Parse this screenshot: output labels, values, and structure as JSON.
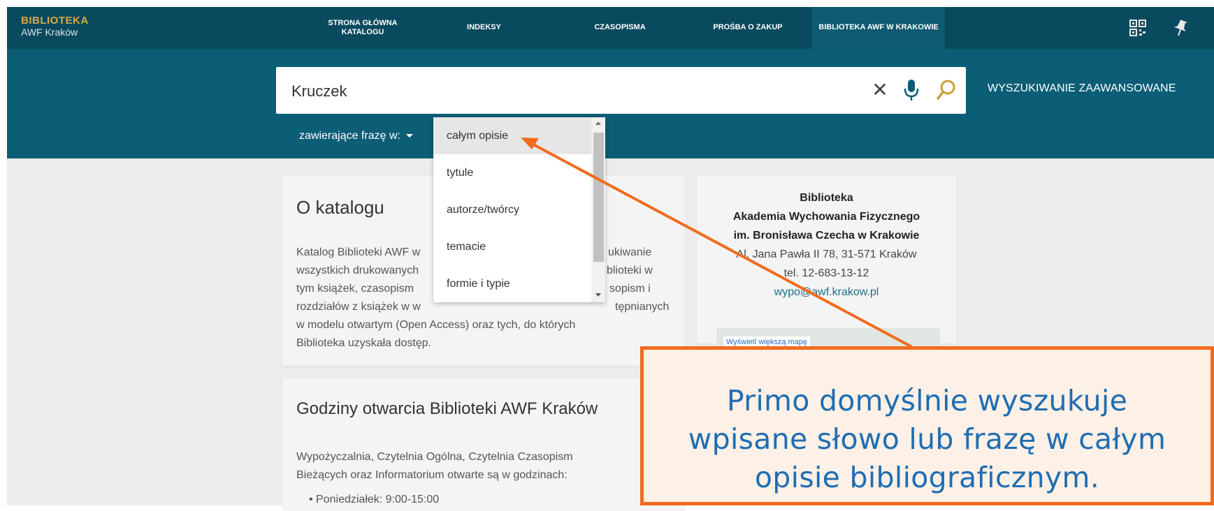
{
  "header": {
    "logo_line1": "BIBLIOTEKA",
    "logo_line2": "AWF Kraków",
    "nav": [
      {
        "label": "STRONA GŁÓWNA KATALOGU"
      },
      {
        "label": "INDEKSY"
      },
      {
        "label": "CZASOPISMA"
      },
      {
        "label": "PROŚBA O ZAKUP"
      },
      {
        "label": "BIBLIOTEKA AWF W KRAKOWIE"
      }
    ],
    "icons": [
      "qr-code-icon",
      "pin-icon"
    ]
  },
  "search": {
    "query": "Kruczek",
    "advanced_label": "WYSZUKIWANIE ZAAWANSOWANE",
    "scope_label": "zawierające frazę w:"
  },
  "scope_dropdown": {
    "options": [
      "całym opisie",
      "tytule",
      "autorze/twórcy",
      "temacie",
      "formie i typie"
    ],
    "selected": "całym opisie"
  },
  "about": {
    "title": "O katalogu",
    "lines": [
      "Katalog Biblioteki AWF w",
      "wszystkich drukowanych",
      "tym książek, czasopism",
      "rozdziałów z książek w w",
      "w modelu otwartym (Open Access) oraz tych, do których",
      "Biblioteka uzyskała dostęp."
    ],
    "right_frags": [
      "ukiwanie",
      "blioteki w",
      "sopism i",
      "tępnianych"
    ]
  },
  "hours": {
    "title": "Godziny otwarcia Biblioteki AWF Kraków",
    "line1": "Wypożyczalnia, Czytelnia Ogólna, Czytelnia Czasopism",
    "line2": "Bieżących oraz Informatorium otwarte są w godzinach:",
    "item1": "Poniedziałek: 9:00-15:00"
  },
  "library_info": {
    "name1": "Biblioteka",
    "name2": "Akademia Wychowania Fizycznego",
    "name3": "im. Bronisława Czecha w Krakowie",
    "address": "Al. Jana Pawła II 78, 31-571 Kraków",
    "phone": "tel. 12-683-13-12",
    "email": "wypo@awf.krakow.pl",
    "map_button": "Wyświetl większą mapę"
  },
  "callout": {
    "line1": "Primo domyślnie wyszukuje",
    "line2": "wpisane słowo lub frazę w całym",
    "line3": "opisie bibliograficznym."
  },
  "colors": {
    "topbar": "#0a4a5e",
    "search_band": "#0c5d76",
    "logo_gold": "#d8aa3e",
    "callout_border": "#f26b1d",
    "callout_text": "#1e6db2"
  }
}
